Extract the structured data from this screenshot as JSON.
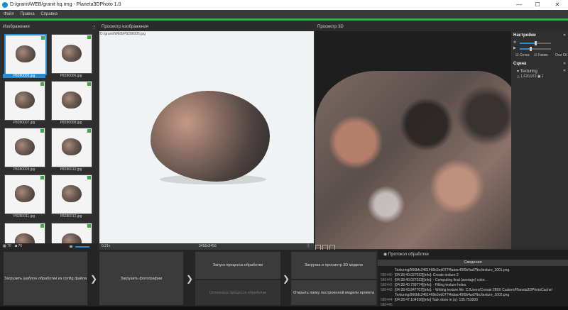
{
  "window": {
    "title": "D:/granit/WEB/granit hq.rmg - Planeta3DPhoto 1.0",
    "minimize": "—",
    "maximize": "☐",
    "close": "✕"
  },
  "menu": [
    "Файл",
    "Правка",
    "Справка"
  ],
  "images_panel": {
    "title": "Изображения",
    "menu_icon": "⋮",
    "thumbnails": [
      {
        "label": "P8280005.jpg",
        "selected": true
      },
      {
        "label": "P8280006.jpg",
        "selected": false
      },
      {
        "label": "P8280007.jpg",
        "selected": false
      },
      {
        "label": "P8280008.jpg",
        "selected": false
      },
      {
        "label": "P8280009.jpg",
        "selected": false
      },
      {
        "label": "P8280010.jpg",
        "selected": false
      },
      {
        "label": "P8280011.jpg",
        "selected": false
      },
      {
        "label": "P8280012.jpg",
        "selected": false
      },
      {
        "label": "",
        "selected": false
      },
      {
        "label": "",
        "selected": false
      }
    ],
    "count_total": "70",
    "count_loaded": "70"
  },
  "preview_panel": {
    "title": "Просмотр изображения",
    "path": "D:/granit/WEB/P8280005.jpg",
    "zoom": "0.21x",
    "size": "3456x3456",
    "info_icon": "ⓘ"
  },
  "view3d_panel": {
    "title": "Просмотр 3D"
  },
  "settings": {
    "title": "Настройки",
    "close": "✕",
    "options": [
      "Сетка",
      "Гизмо",
      "Оси СК"
    ],
    "slider1": 0.5,
    "slider2": 0.35
  },
  "scene": {
    "title": "Сцена",
    "close": "✕",
    "item": "Texturing",
    "polygons": "1,620,973",
    "textures": "1"
  },
  "workflow": {
    "load_template": "Загрузить шаблон обработки из config файла",
    "load_photos": "Загрузить фотографии",
    "start_processing": "Запуск процесса обработки",
    "stop_processing": "Остановка процесса обработки",
    "load_view_3d": "Загрузка и просмотр 3D модели",
    "open_folder": "Открыть папку построенной модели проекта",
    "arrow": "❯"
  },
  "log": {
    "title": "Протокол обработки",
    "header": "Сведения",
    "lines": [
      {
        "num": "",
        "text": "Texturing/966bfc2461468e3ed077f4abac45f0b4ad7fbc/texture_1001.png"
      },
      {
        "num": "580440",
        "text": "[04:28:40.027023][info]: Create texture 2"
      },
      {
        "num": "580441",
        "text": "[04:28:40.027023][info]:   - Computing final (average) color."
      },
      {
        "num": "580442",
        "text": "[04:28:40.739774][info]:   - Filling texture holes."
      },
      {
        "num": "580443",
        "text": "[04:28:43.847707][info]:   - Writing texture file: C:/Users/Corsair 280X Custom/Planeta3DPhotoCache/"
      },
      {
        "num": "",
        "text": "Texturing/966bfc2461468e3ed077f4abac45f0b4ad7fbc/texture_1002.png"
      },
      {
        "num": "580444",
        "text": "[04:28:47.104936][info] Task done in (s): 135.753000"
      },
      {
        "num": "580445",
        "text": ""
      }
    ]
  },
  "colors": {
    "accent": "#2d8ad0",
    "progress_green": "#3fa845"
  }
}
